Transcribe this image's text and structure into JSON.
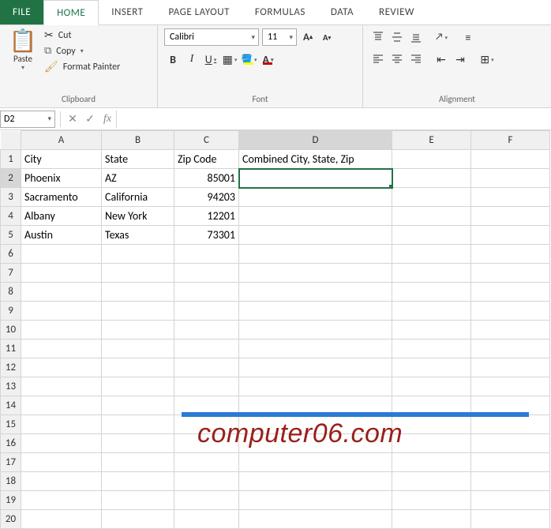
{
  "tabs": {
    "file": "FILE",
    "home": "HOME",
    "insert": "INSERT",
    "pagelayout": "PAGE LAYOUT",
    "formulas": "FORMULAS",
    "data": "DATA",
    "review": "REVIEW"
  },
  "clipboard": {
    "paste": "Paste",
    "cut": "Cut",
    "copy": "Copy",
    "formatpainter": "Format Painter",
    "label": "Clipboard"
  },
  "font": {
    "name": "Calibri",
    "size": "11",
    "label": "Font"
  },
  "alignment": {
    "label": "Alignment"
  },
  "formula_bar": {
    "namebox": "D2",
    "formula": ""
  },
  "columns": [
    "A",
    "B",
    "C",
    "D",
    "E",
    "F"
  ],
  "rows": [
    {
      "n": "1",
      "A": "City",
      "B": "State",
      "C": "Zip Code",
      "D": "Combined City, State, Zip",
      "E": "",
      "F": ""
    },
    {
      "n": "2",
      "A": "Phoenix",
      "B": "AZ",
      "C": "85001",
      "D": "",
      "E": "",
      "F": ""
    },
    {
      "n": "3",
      "A": "Sacramento",
      "B": "California",
      "C": "94203",
      "D": "",
      "E": "",
      "F": ""
    },
    {
      "n": "4",
      "A": "Albany",
      "B": "New York",
      "C": "12201",
      "D": "",
      "E": "",
      "F": ""
    },
    {
      "n": "5",
      "A": "Austin",
      "B": "Texas",
      "C": "73301",
      "D": "",
      "E": "",
      "F": ""
    }
  ],
  "empty_rows": 15,
  "selected": {
    "row": 2,
    "col": "D"
  },
  "watermark": "computer06.com"
}
